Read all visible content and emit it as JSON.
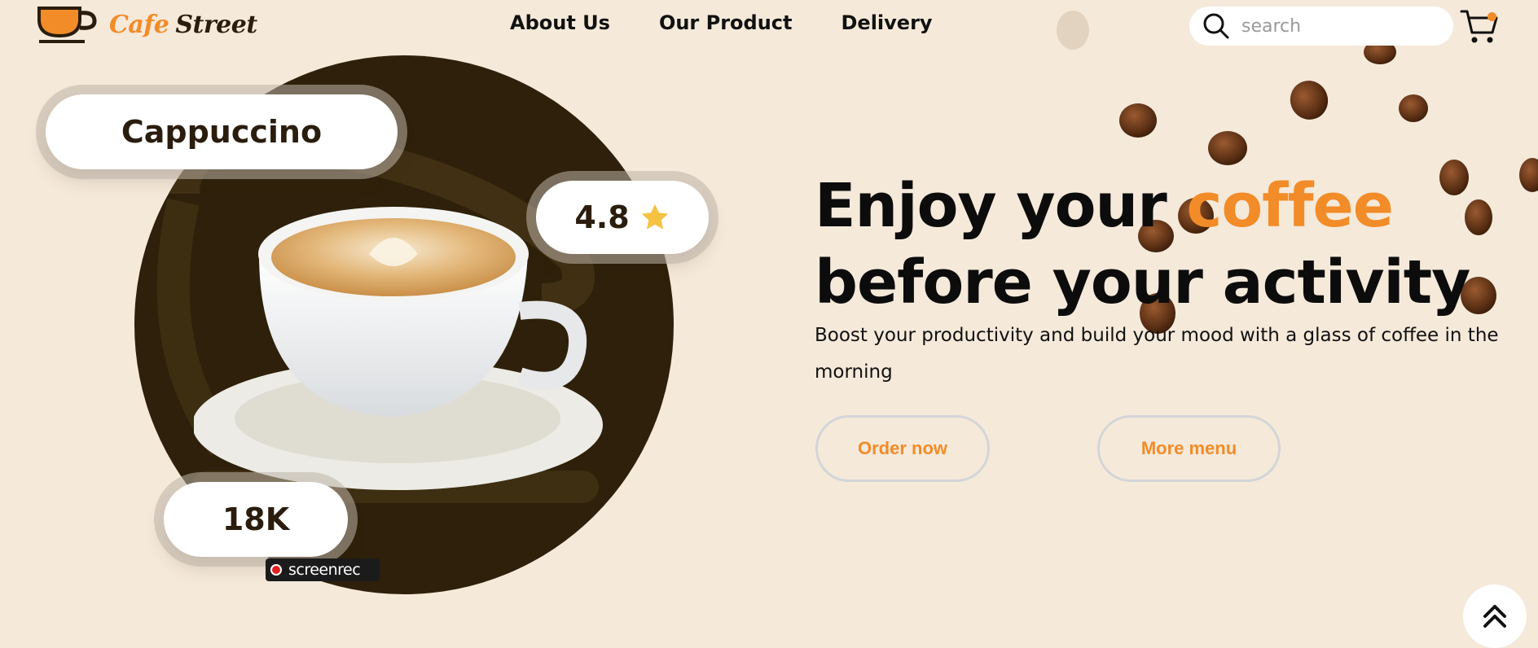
{
  "brand": {
    "word1": "Cafe",
    "word2": "Street"
  },
  "nav": {
    "items": [
      "About Us",
      "Our Product",
      "Delivery"
    ]
  },
  "search": {
    "placeholder": "search"
  },
  "hero": {
    "product_name": "Cappuccino",
    "rating": "4.8",
    "count": "18K",
    "headline_part1": "Enjoy your ",
    "headline_accent": "coffee",
    "headline_part2": "before your activity",
    "subtext": "Boost your productivity and build your mood with a glass of coffee in the morning",
    "order_label": "Order now",
    "menu_label": "More menu"
  },
  "watermark": {
    "label": "screenrec"
  },
  "colors": {
    "background": "#F5E9DA",
    "accent": "#F28C28",
    "dark_brown": "#2E200A",
    "star": "#F5C242"
  },
  "icons": {
    "logo": "coffee-cup-logo-icon",
    "search": "search-icon",
    "cart": "cart-icon",
    "rating": "star-icon",
    "scroll": "double-chevron-up-icon"
  }
}
